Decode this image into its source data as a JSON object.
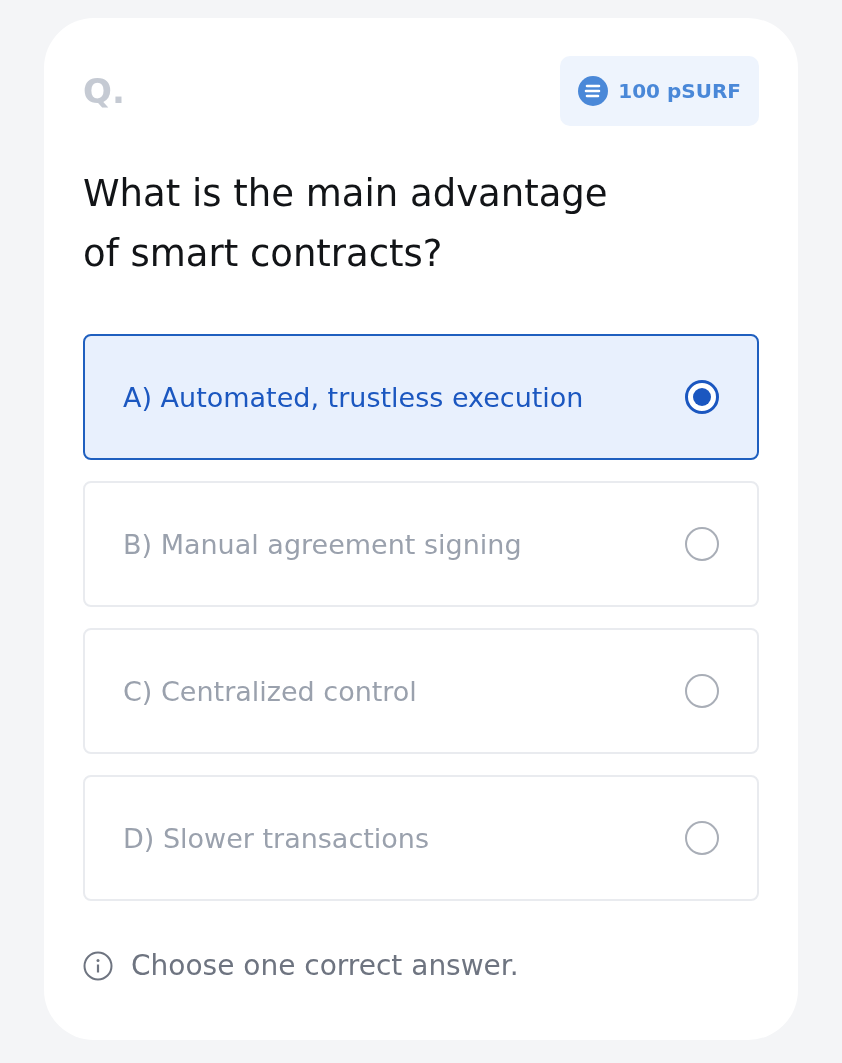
{
  "question": {
    "label": "Q.",
    "reward": "100 pSURF",
    "text": "What is the main advantage of smart contracts?"
  },
  "options": [
    {
      "label": "A) Automated, trustless execution",
      "selected": true
    },
    {
      "label": "B) Manual agreement signing",
      "selected": false
    },
    {
      "label": "C) Centralized control",
      "selected": false
    },
    {
      "label": "D) Slower transactions",
      "selected": false
    }
  ],
  "hint": "Choose one correct answer."
}
